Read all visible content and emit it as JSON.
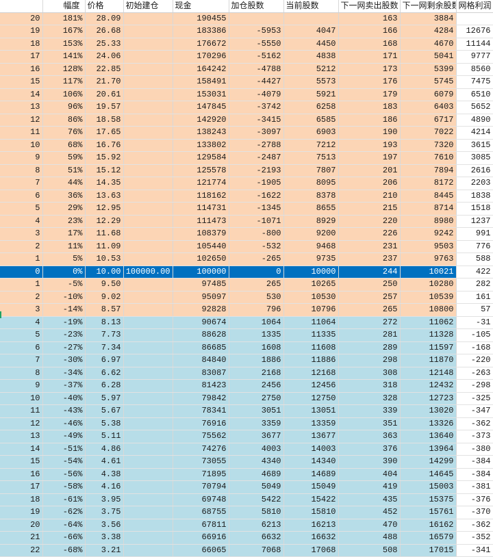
{
  "headers": [
    "",
    "幅度",
    "价格",
    "初始建仓",
    "现金",
    "加仓股数",
    "当前股数",
    "下一网卖出股数",
    "下一网剩余股数",
    "网格利润"
  ],
  "colors": {
    "up_row": "#fcd5b5",
    "down_row": "#b7dde8",
    "base_row": "#0070c0"
  },
  "rows": [
    {
      "kind": "up",
      "c": [
        "20",
        "181%",
        "28.09",
        "",
        "190455",
        "",
        "",
        "163",
        "3884",
        ""
      ]
    },
    {
      "kind": "up",
      "c": [
        "19",
        "167%",
        "26.68",
        "",
        "183386",
        "-5953",
        "4047",
        "166",
        "4284",
        "12676"
      ]
    },
    {
      "kind": "up",
      "c": [
        "18",
        "153%",
        "25.33",
        "",
        "176672",
        "-5550",
        "4450",
        "168",
        "4670",
        "11144"
      ]
    },
    {
      "kind": "up",
      "c": [
        "17",
        "141%",
        "24.06",
        "",
        "170296",
        "-5162",
        "4838",
        "171",
        "5041",
        "9777"
      ]
    },
    {
      "kind": "up",
      "c": [
        "16",
        "128%",
        "22.85",
        "",
        "164242",
        "-4788",
        "5212",
        "173",
        "5399",
        "8560"
      ]
    },
    {
      "kind": "up",
      "c": [
        "15",
        "117%",
        "21.70",
        "",
        "158491",
        "-4427",
        "5573",
        "176",
        "5745",
        "7475"
      ]
    },
    {
      "kind": "up",
      "c": [
        "14",
        "106%",
        "20.61",
        "",
        "153031",
        "-4079",
        "5921",
        "179",
        "6079",
        "6510"
      ]
    },
    {
      "kind": "up",
      "c": [
        "13",
        "96%",
        "19.57",
        "",
        "147845",
        "-3742",
        "6258",
        "183",
        "6403",
        "5652"
      ]
    },
    {
      "kind": "up",
      "c": [
        "12",
        "86%",
        "18.58",
        "",
        "142920",
        "-3415",
        "6585",
        "186",
        "6717",
        "4890"
      ]
    },
    {
      "kind": "up",
      "c": [
        "11",
        "76%",
        "17.65",
        "",
        "138243",
        "-3097",
        "6903",
        "190",
        "7022",
        "4214"
      ]
    },
    {
      "kind": "up",
      "c": [
        "10",
        "68%",
        "16.76",
        "",
        "133802",
        "-2788",
        "7212",
        "193",
        "7320",
        "3615"
      ]
    },
    {
      "kind": "up",
      "c": [
        "9",
        "59%",
        "15.92",
        "",
        "129584",
        "-2487",
        "7513",
        "197",
        "7610",
        "3085"
      ]
    },
    {
      "kind": "up",
      "c": [
        "8",
        "51%",
        "15.12",
        "",
        "125578",
        "-2193",
        "7807",
        "201",
        "7894",
        "2616"
      ]
    },
    {
      "kind": "up",
      "c": [
        "7",
        "44%",
        "14.35",
        "",
        "121774",
        "-1905",
        "8095",
        "206",
        "8172",
        "2203"
      ]
    },
    {
      "kind": "up",
      "c": [
        "6",
        "36%",
        "13.63",
        "",
        "118162",
        "-1622",
        "8378",
        "210",
        "8445",
        "1838"
      ]
    },
    {
      "kind": "up",
      "c": [
        "5",
        "29%",
        "12.95",
        "",
        "114731",
        "-1345",
        "8655",
        "215",
        "8714",
        "1518"
      ]
    },
    {
      "kind": "up",
      "c": [
        "4",
        "23%",
        "12.29",
        "",
        "111473",
        "-1071",
        "8929",
        "220",
        "8980",
        "1237"
      ]
    },
    {
      "kind": "up",
      "c": [
        "3",
        "17%",
        "11.68",
        "",
        "108379",
        "-800",
        "9200",
        "226",
        "9242",
        "991"
      ]
    },
    {
      "kind": "up",
      "c": [
        "2",
        "11%",
        "11.09",
        "",
        "105440",
        "-532",
        "9468",
        "231",
        "9503",
        "776"
      ]
    },
    {
      "kind": "up",
      "c": [
        "1",
        "5%",
        "10.53",
        "",
        "102650",
        "-265",
        "9735",
        "237",
        "9763",
        "588"
      ]
    },
    {
      "kind": "base",
      "c": [
        "0",
        "0%",
        "10.00",
        "100000.00",
        "100000",
        "0",
        "10000",
        "244",
        "10021",
        "422"
      ]
    },
    {
      "kind": "up",
      "c": [
        "1",
        "-5%",
        "9.50",
        "",
        "97485",
        "265",
        "10265",
        "250",
        "10280",
        "282"
      ]
    },
    {
      "kind": "up",
      "c": [
        "2",
        "-10%",
        "9.02",
        "",
        "95097",
        "530",
        "10530",
        "257",
        "10539",
        "161"
      ]
    },
    {
      "kind": "up",
      "c": [
        "3",
        "-14%",
        "8.57",
        "",
        "92828",
        "796",
        "10796",
        "265",
        "10800",
        "57"
      ]
    },
    {
      "kind": "down",
      "c": [
        "4",
        "-19%",
        "8.13",
        "",
        "90674",
        "1064",
        "11064",
        "272",
        "11062",
        "-31"
      ]
    },
    {
      "kind": "down",
      "c": [
        "5",
        "-23%",
        "7.73",
        "",
        "88628",
        "1335",
        "11335",
        "281",
        "11328",
        "-105"
      ]
    },
    {
      "kind": "down",
      "c": [
        "6",
        "-27%",
        "7.34",
        "",
        "86685",
        "1608",
        "11608",
        "289",
        "11597",
        "-168"
      ]
    },
    {
      "kind": "down",
      "c": [
        "7",
        "-30%",
        "6.97",
        "",
        "84840",
        "1886",
        "11886",
        "298",
        "11870",
        "-220"
      ]
    },
    {
      "kind": "down",
      "c": [
        "8",
        "-34%",
        "6.62",
        "",
        "83087",
        "2168",
        "12168",
        "308",
        "12148",
        "-263"
      ]
    },
    {
      "kind": "down",
      "c": [
        "9",
        "-37%",
        "6.28",
        "",
        "81423",
        "2456",
        "12456",
        "318",
        "12432",
        "-298"
      ]
    },
    {
      "kind": "down",
      "c": [
        "10",
        "-40%",
        "5.97",
        "",
        "79842",
        "2750",
        "12750",
        "328",
        "12723",
        "-325"
      ]
    },
    {
      "kind": "down",
      "c": [
        "11",
        "-43%",
        "5.67",
        "",
        "78341",
        "3051",
        "13051",
        "339",
        "13020",
        "-347"
      ]
    },
    {
      "kind": "down",
      "c": [
        "12",
        "-46%",
        "5.38",
        "",
        "76916",
        "3359",
        "13359",
        "351",
        "13326",
        "-362"
      ]
    },
    {
      "kind": "down",
      "c": [
        "13",
        "-49%",
        "5.11",
        "",
        "75562",
        "3677",
        "13677",
        "363",
        "13640",
        "-373"
      ]
    },
    {
      "kind": "down",
      "c": [
        "14",
        "-51%",
        "4.86",
        "",
        "74276",
        "4003",
        "14003",
        "376",
        "13964",
        "-380"
      ]
    },
    {
      "kind": "down",
      "c": [
        "15",
        "-54%",
        "4.61",
        "",
        "73055",
        "4340",
        "14340",
        "390",
        "14299",
        "-384"
      ]
    },
    {
      "kind": "down",
      "c": [
        "16",
        "-56%",
        "4.38",
        "",
        "71895",
        "4689",
        "14689",
        "404",
        "14645",
        "-384"
      ]
    },
    {
      "kind": "down",
      "c": [
        "17",
        "-58%",
        "4.16",
        "",
        "70794",
        "5049",
        "15049",
        "419",
        "15003",
        "-381"
      ]
    },
    {
      "kind": "down",
      "c": [
        "18",
        "-61%",
        "3.95",
        "",
        "69748",
        "5422",
        "15422",
        "435",
        "15375",
        "-376"
      ]
    },
    {
      "kind": "down",
      "c": [
        "19",
        "-62%",
        "3.75",
        "",
        "68755",
        "5810",
        "15810",
        "452",
        "15761",
        "-370"
      ]
    },
    {
      "kind": "down",
      "c": [
        "20",
        "-64%",
        "3.56",
        "",
        "67811",
        "6213",
        "16213",
        "470",
        "16162",
        "-362"
      ]
    },
    {
      "kind": "down",
      "c": [
        "21",
        "-66%",
        "3.38",
        "",
        "66916",
        "6632",
        "16632",
        "488",
        "16579",
        "-352"
      ]
    },
    {
      "kind": "down",
      "c": [
        "22",
        "-68%",
        "3.21",
        "",
        "66065",
        "7068",
        "17068",
        "508",
        "17015",
        "-341"
      ]
    }
  ]
}
